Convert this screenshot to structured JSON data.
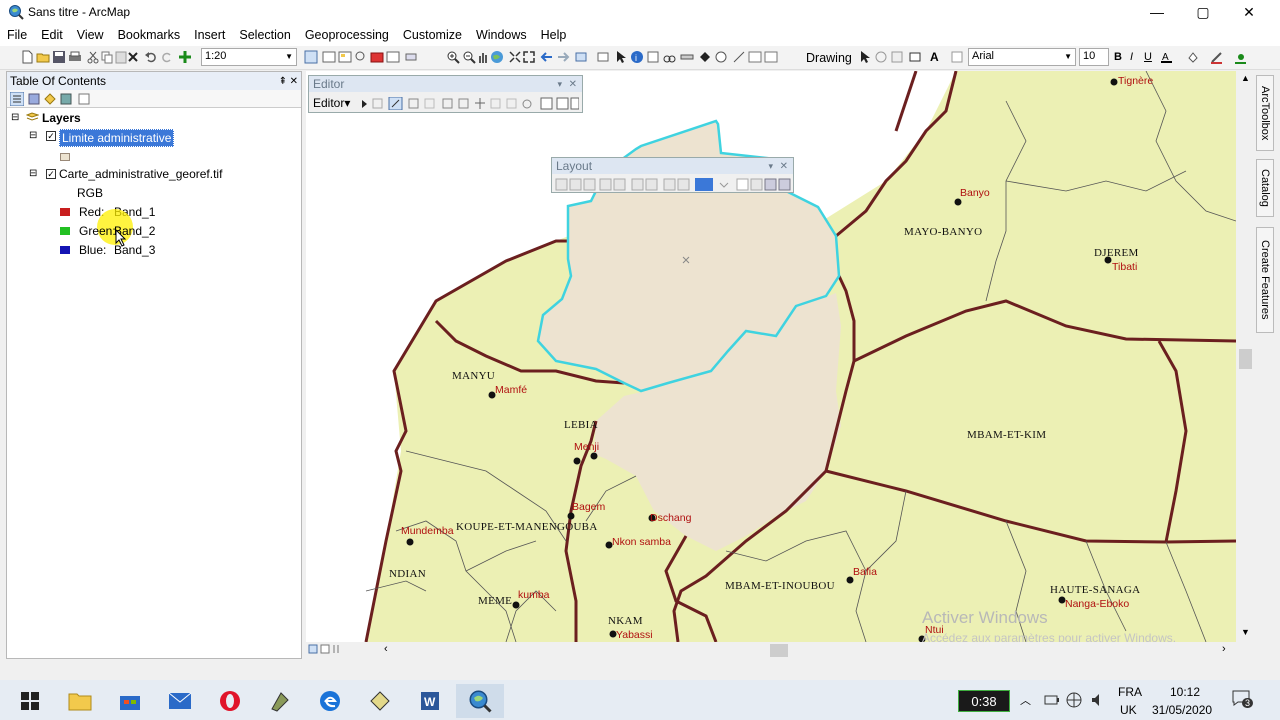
{
  "window": {
    "title": "Sans titre - ArcMap",
    "minimize": "—",
    "maximize": "▢",
    "close": "✕"
  },
  "menu": [
    "File",
    "Edit",
    "View",
    "Bookmarks",
    "Insert",
    "Selection",
    "Geoprocessing",
    "Customize",
    "Windows",
    "Help"
  ],
  "toolbar": {
    "scale": "1:20",
    "drawing_label": "Drawing",
    "font": "Arial",
    "font_size": "10",
    "text_tool": "A"
  },
  "toc": {
    "title": "Table Of Contents",
    "root": "Layers",
    "layer1": {
      "name": "Limite administrative",
      "checked": "✓"
    },
    "layer2": {
      "name": "Carte_administrative_georef.tif",
      "checked": "✓"
    },
    "rgb": "RGB",
    "bands": [
      {
        "label": "Red:",
        "value": "Band_1",
        "color": "#c81e1e"
      },
      {
        "label": "Green:",
        "value": "Band_2",
        "color": "#22c022"
      },
      {
        "label": "Blue:",
        "value": "Band_3",
        "color": "#1414b4"
      }
    ],
    "expand": "⊟"
  },
  "editor": {
    "title": "Editor",
    "menu": "Editor▾"
  },
  "layout": {
    "title": "Layout"
  },
  "dock": [
    "ArcToolbox",
    "Catalog",
    "Create Features"
  ],
  "map": {
    "departments": [
      {
        "name": "MAYO-BANYO"
      },
      {
        "name": "DJEREM"
      },
      {
        "name": "MANYU"
      },
      {
        "name": "MBAM-ET-KIM"
      },
      {
        "name": "LEBIA"
      },
      {
        "name": "KOUPE-ET-MANENGOUBA"
      },
      {
        "name": "NDIAN"
      },
      {
        "name": "MEME"
      },
      {
        "name": "MBAM-ET-INOUBOU"
      },
      {
        "name": "NKAM"
      },
      {
        "name": "HAUTE-SANAGA"
      }
    ],
    "places": [
      {
        "name": "Tignère"
      },
      {
        "name": "Banyo"
      },
      {
        "name": "Tibati"
      },
      {
        "name": "Mamfé"
      },
      {
        "name": "Menji"
      },
      {
        "name": "Bagem"
      },
      {
        "name": "Mundemba"
      },
      {
        "name": "Nkon samba"
      },
      {
        "name": "kumba"
      },
      {
        "name": "Yabassi"
      },
      {
        "name": "Bafia"
      },
      {
        "name": "Nanga-Eboko"
      },
      {
        "name": "Ntui"
      },
      {
        "name": "Dschang"
      }
    ],
    "watermark_title": "Activer Windows",
    "watermark_sub": "Accédez aux paramètres pour activer Windows."
  },
  "taskbar": {
    "timer": "0:38",
    "lang": "FRA",
    "region": "UK",
    "time": "10:12",
    "date": "31/05/2020",
    "notif": "3"
  },
  "colors": {
    "land": "#ecf0b4",
    "selected": "#ede3d0",
    "border": "#6b1f1f",
    "highlight": "#3fd3e0",
    "selection": "#3b78d8"
  }
}
